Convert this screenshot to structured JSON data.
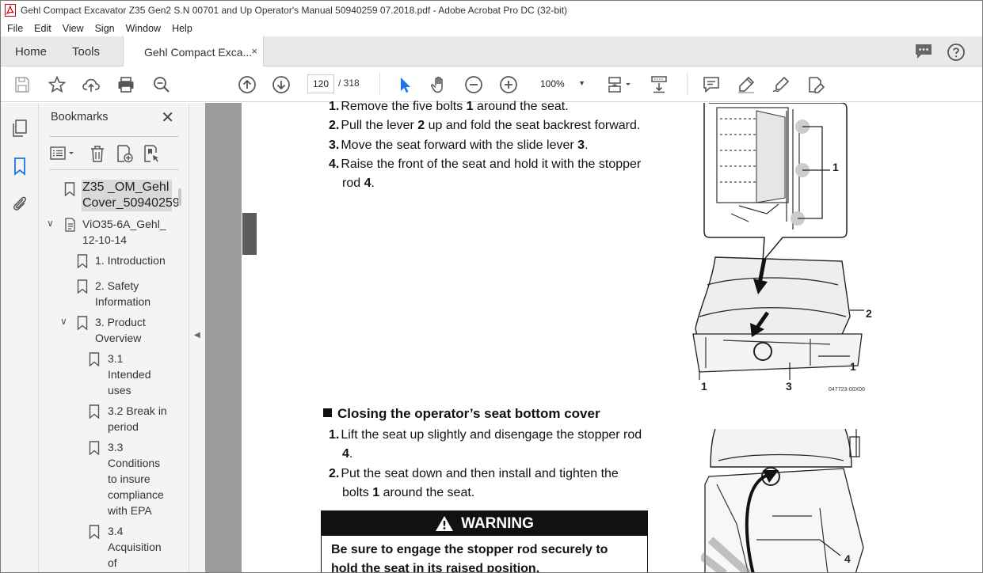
{
  "window": {
    "title": "Gehl Compact Excavator Z35 Gen2 S.N 00701 and Up Operator's Manual 50940259 07.2018.pdf - Adobe Acrobat Pro DC (32-bit)"
  },
  "menu": [
    "File",
    "Edit",
    "View",
    "Sign",
    "Window",
    "Help"
  ],
  "tabs": {
    "home": "Home",
    "tools": "Tools",
    "doc": "Gehl Compact Exca...",
    "close": "×"
  },
  "toolbar": {
    "page_current": "120",
    "page_total": "/  318",
    "zoom": "100%"
  },
  "bookmarks": {
    "header": "Bookmarks",
    "close": "✕",
    "items": [
      {
        "label1": "Z35 _OM_Gehl",
        "label2": "Cover_50940259"
      },
      {
        "label1": "ViO35-6A_Gehl_",
        "label2": "12-10-14"
      },
      {
        "label1": "1. Introduction"
      },
      {
        "label1": "2. Safety",
        "label2": "Information"
      },
      {
        "label1": "3. Product",
        "label2": "Overview"
      },
      {
        "label1": "3.1",
        "label2": "Intended",
        "label3": "uses"
      },
      {
        "label1": "3.2 Break in",
        "label2": "period"
      },
      {
        "label1": "3.3",
        "label2": "Conditions",
        "label3": "to insure",
        "label4": "compliance",
        "label5": "with EPA"
      },
      {
        "label1": "3.4",
        "label2": "Acquisition",
        "label3": "of"
      }
    ]
  },
  "page": {
    "steps_open": [
      {
        "num": "1.",
        "text_a": "Remove the five bolts ",
        "bold": "1",
        "text_b": " around the seat."
      },
      {
        "num": "2.",
        "text_a": "Pull the lever ",
        "bold": "2",
        "text_b": " up and fold the seat backrest forward."
      },
      {
        "num": "3.",
        "text_a": "Move the seat forward with the slide lever ",
        "bold": "3",
        "text_b": "."
      },
      {
        "num": "4.",
        "text_a": "Raise the front of the seat and hold it with the stopper",
        "cont_a": "rod ",
        "bold": "4",
        "cont_b": "."
      }
    ],
    "section_title": "Closing the operator’s seat bottom cover",
    "steps_close": [
      {
        "num": "1.",
        "text_a": "Lift the seat up slightly and disengage the stopper rod",
        "bold": "4",
        "cont_b": "."
      },
      {
        "num": "2.",
        "text_a": "Put the seat down and then install and tighten the",
        "cont_a": "bolts ",
        "bold": "1",
        "cont_b": " around the seat."
      }
    ],
    "warning_title": "WARNING",
    "warning_line1": "Be sure to engage the stopper rod securely to",
    "warning_line2": "hold the seat in its raised position.",
    "fig1_labels": {
      "l1": "1",
      "l2": "2",
      "l3": "3",
      "l4": "1",
      "l5": "1",
      "code": "047723-00X00"
    },
    "fig2_label": "4"
  }
}
